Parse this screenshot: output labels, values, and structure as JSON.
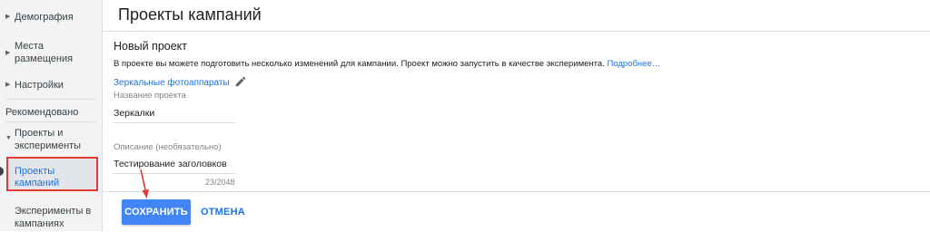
{
  "sidebar": {
    "items": [
      {
        "label": "Демография"
      },
      {
        "label": "Места размещения"
      },
      {
        "label": "Настройки"
      }
    ],
    "section_label": "Рекомендовано",
    "group": {
      "label": "Проекты и эксперименты"
    },
    "active_item": {
      "label": "Проекты кампаний"
    },
    "next_item": {
      "label": "Эксперименты в кампаниях"
    }
  },
  "header": {
    "title": "Проекты кампаний"
  },
  "main": {
    "project_heading": "Новый проект",
    "description": "В проекте вы можете подготовить несколько изменений для кампании. Проект можно запустить в качестве эксперимента.",
    "more_link": "Подробнее…",
    "campaign_link": "Зеркальные фотоаппараты",
    "name_field": {
      "label": "Название проекта",
      "value": "Зеркалки"
    },
    "description_field": {
      "label": "Описание (необязательно)",
      "value": "Тестирование заголовков",
      "counter": "23/2048"
    },
    "save_label": "СОХРАНИТЬ",
    "cancel_label": "ОТМЕНА"
  },
  "colors": {
    "accent": "#1a73e8",
    "save_button": "#4285f4",
    "highlight": "#e53935"
  },
  "icons": {
    "edit": "pencil-icon",
    "arrow": "red-arrow-annotation"
  }
}
